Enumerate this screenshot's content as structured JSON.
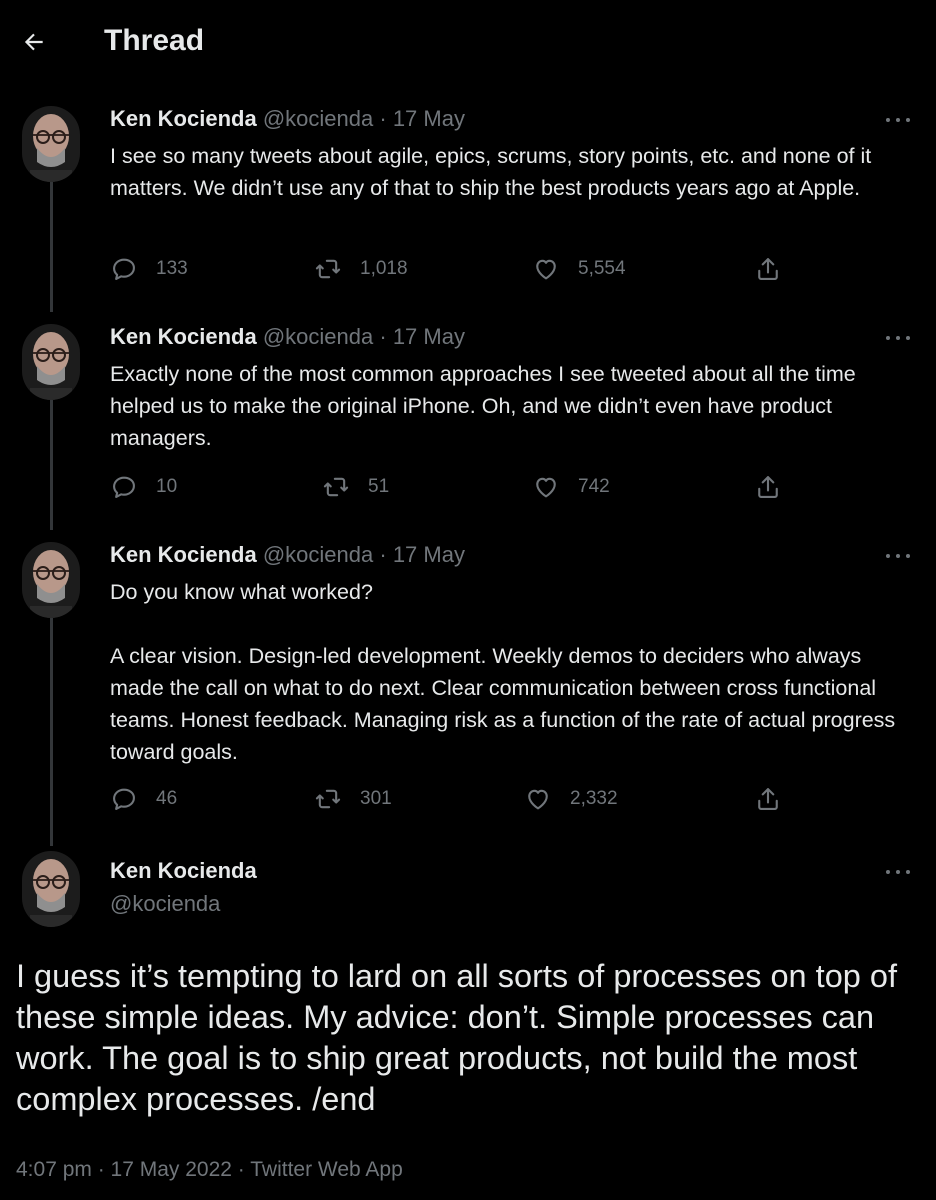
{
  "header": {
    "title": "Thread"
  },
  "tweets": [
    {
      "name": "Ken Kocienda",
      "handle": "@kocienda",
      "separator": "·",
      "date": "17 May",
      "paragraphs": [
        "I see so many tweets about agile, epics, scrums, story points, etc. and none of it matters. We didn’t use any of that to ship the best products years ago at Apple."
      ],
      "replies": "133",
      "retweets": "1,018",
      "likes": "5,554"
    },
    {
      "name": "Ken Kocienda",
      "handle": "@kocienda",
      "separator": "·",
      "date": "17 May",
      "paragraphs": [
        "Exactly none of the most common approaches I see tweeted about all the time helped us to make the original iPhone.  Oh, and we didn’t even have product managers."
      ],
      "replies": "10",
      "retweets": "51",
      "likes": "742"
    },
    {
      "name": "Ken Kocienda",
      "handle": "@kocienda",
      "separator": "·",
      "date": "17 May",
      "paragraphs": [
        "Do you know what worked?",
        "A clear vision. Design-led development. Weekly demos to deciders who always made the call on what to do next. Clear communication between cross functional teams. Honest feedback. Managing risk as a function of the rate of actual progress toward goals."
      ],
      "replies": "46",
      "retweets": "301",
      "likes": "2,332"
    }
  ],
  "main_tweet": {
    "name": "Ken Kocienda",
    "handle": "@kocienda",
    "text": "I guess it’s tempting to lard on all sorts of processes on top of these simple ideas. My advice: don’t. Simple processes can work. The goal is to ship great products, not build the most complex processes. /end",
    "meta": "4:07 pm · 17 May 2022 · Twitter Web App"
  },
  "icons": {
    "back": "arrow-left-icon",
    "reply": "reply-icon",
    "retweet": "retweet-icon",
    "like": "heart-icon",
    "share": "share-icon",
    "more": "more-icon"
  },
  "colors": {
    "background": "#000000",
    "text": "#e7e9ea",
    "muted": "#71767b",
    "thread_line": "#333639"
  }
}
